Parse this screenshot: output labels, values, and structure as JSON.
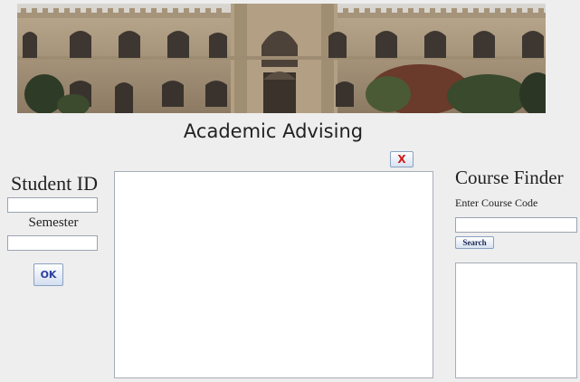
{
  "header": {
    "title": "Academic Advising",
    "close_label": "X"
  },
  "student": {
    "id_label": "Student ID",
    "id_value": "",
    "semester_label": "Semester",
    "semester_value": "",
    "ok_label": "OK"
  },
  "course_finder": {
    "title": "Course Finder",
    "code_label": "Enter Course Code",
    "code_value": "",
    "search_label": "Search"
  },
  "colors": {
    "background": "#eeeeee",
    "close_text": "#d31a1a",
    "ok_text": "#2b3fa0"
  },
  "icons": {
    "banner": "college-building-image"
  }
}
